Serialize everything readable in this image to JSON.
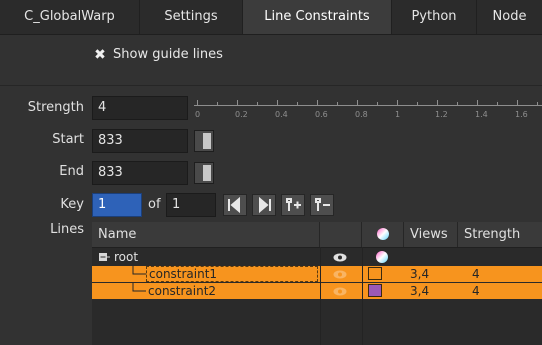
{
  "tabs": [
    {
      "label": "C_GlobalWarp",
      "active": false
    },
    {
      "label": "Settings",
      "active": false
    },
    {
      "label": "Line Constraints",
      "active": true
    },
    {
      "label": "Python",
      "active": false
    },
    {
      "label": "Node",
      "active": false
    }
  ],
  "show_guide": {
    "checked": true,
    "label": "Show guide lines"
  },
  "params": {
    "strength": {
      "label": "Strength",
      "value": "4"
    },
    "start": {
      "label": "Start",
      "value": "833"
    },
    "end": {
      "label": "End",
      "value": "833"
    },
    "key": {
      "label": "Key",
      "value": "1",
      "of_label": "of",
      "total": "1"
    },
    "lines": {
      "label": "Lines"
    }
  },
  "slider": {
    "min": 0,
    "max": 1.6,
    "tick_labels": [
      "0",
      "0.2",
      "0.4",
      "0.6",
      "0.8",
      "1",
      "1.2",
      "1.4",
      "1.6"
    ]
  },
  "key_buttons": [
    {
      "icon": "prev-key-icon",
      "glyph": "⏮"
    },
    {
      "icon": "next-key-icon",
      "glyph": "⏭"
    },
    {
      "icon": "add-key-icon",
      "glyph": "ᛈ+"
    },
    {
      "icon": "remove-key-icon",
      "glyph": "ᛈ−"
    }
  ],
  "table": {
    "headers": [
      "Name",
      "",
      "",
      "Views",
      "Strength"
    ],
    "rows": [
      {
        "name": "root",
        "views": "",
        "strength": "",
        "selected": false,
        "color": ""
      },
      {
        "name": "constraint1",
        "views": "3,4",
        "strength": "4",
        "selected": true,
        "color": "#f7941e"
      },
      {
        "name": "constraint2",
        "views": "3,4",
        "strength": "4",
        "selected": true,
        "color": "#9b59b6"
      }
    ]
  },
  "colors": {
    "accent": "#f7941e",
    "selection": "#f7941e"
  }
}
